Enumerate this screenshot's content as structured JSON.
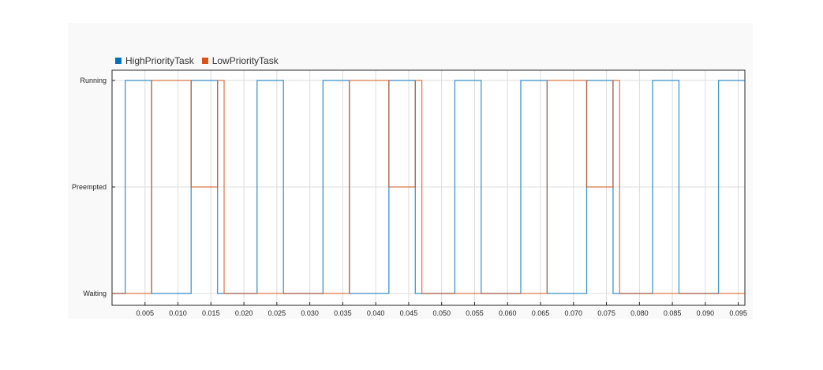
{
  "chart_data": {
    "type": "line",
    "step": true,
    "xlim": [
      0,
      0.096
    ],
    "x_ticks": [
      "0.005",
      "0.010",
      "0.015",
      "0.020",
      "0.025",
      "0.030",
      "0.035",
      "0.040",
      "0.045",
      "0.050",
      "0.055",
      "0.060",
      "0.065",
      "0.070",
      "0.075",
      "0.080",
      "0.085",
      "0.090",
      "0.095"
    ],
    "y_levels": [
      "Waiting",
      "Preempted",
      "Running"
    ],
    "grid": true,
    "legend_position": "top-left",
    "series": [
      {
        "name": "HighPriorityTask",
        "color": "#0072bd",
        "points": [
          [
            0,
            "Waiting"
          ],
          [
            0.002,
            "Running"
          ],
          [
            0.006,
            "Waiting"
          ],
          [
            0.012,
            "Running"
          ],
          [
            0.016,
            "Waiting"
          ],
          [
            0.022,
            "Running"
          ],
          [
            0.026,
            "Waiting"
          ],
          [
            0.032,
            "Running"
          ],
          [
            0.036,
            "Waiting"
          ],
          [
            0.042,
            "Running"
          ],
          [
            0.046,
            "Waiting"
          ],
          [
            0.052,
            "Running"
          ],
          [
            0.056,
            "Waiting"
          ],
          [
            0.062,
            "Running"
          ],
          [
            0.066,
            "Waiting"
          ],
          [
            0.072,
            "Running"
          ],
          [
            0.076,
            "Waiting"
          ],
          [
            0.082,
            "Running"
          ],
          [
            0.086,
            "Waiting"
          ],
          [
            0.092,
            "Running"
          ],
          [
            0.096,
            "Running"
          ]
        ]
      },
      {
        "name": "LowPriorityTask",
        "color": "#d95319",
        "points": [
          [
            0,
            "Waiting"
          ],
          [
            0.006,
            "Running"
          ],
          [
            0.012,
            "Preempted"
          ],
          [
            0.016,
            "Running"
          ],
          [
            0.017,
            "Waiting"
          ],
          [
            0.036,
            "Running"
          ],
          [
            0.042,
            "Preempted"
          ],
          [
            0.046,
            "Running"
          ],
          [
            0.047,
            "Waiting"
          ],
          [
            0.066,
            "Running"
          ],
          [
            0.072,
            "Preempted"
          ],
          [
            0.076,
            "Running"
          ],
          [
            0.077,
            "Waiting"
          ],
          [
            0.096,
            "Waiting"
          ]
        ]
      }
    ]
  }
}
